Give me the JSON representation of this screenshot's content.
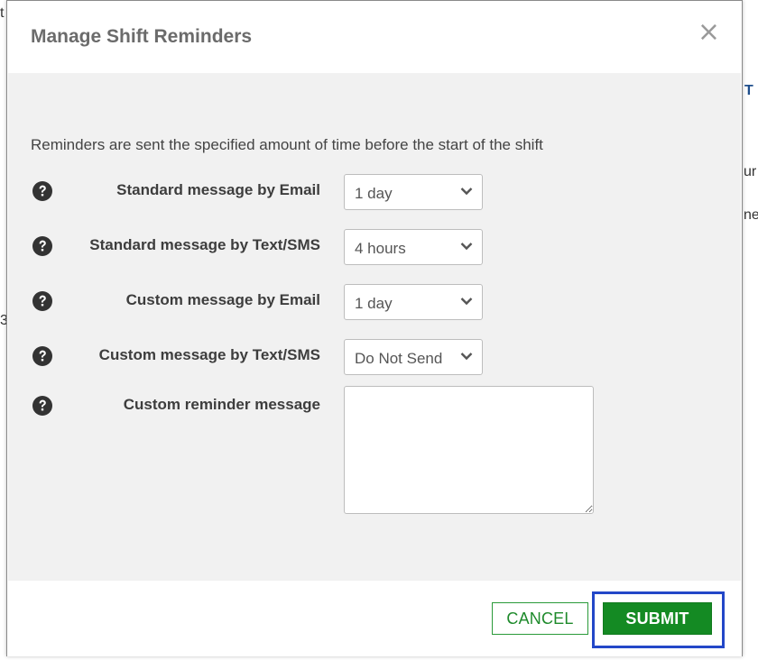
{
  "background": {
    "fragments": [
      "t",
      "T",
      "ur",
      "ne",
      "3"
    ]
  },
  "modal": {
    "title": "Manage Shift Reminders",
    "close_glyph": "×",
    "intro": "Reminders are sent the specified amount of time before the start of the shift",
    "rows": [
      {
        "label": "Standard message by Email",
        "value": "1 day"
      },
      {
        "label": "Standard message by Text/SMS",
        "value": "4 hours"
      },
      {
        "label": "Custom message by Email",
        "value": "1 day"
      },
      {
        "label": "Custom message by Text/SMS",
        "value": "Do Not Send"
      }
    ],
    "custom_reminder": {
      "label": "Custom reminder message",
      "value": ""
    },
    "footer": {
      "cancel_label": "CANCEL",
      "submit_label": "SUBMIT"
    }
  },
  "icons": {
    "help": "question-circle-icon",
    "dropdown": "chevron-down-icon",
    "close": "close-icon"
  },
  "colors": {
    "accent_green": "#148a23",
    "highlight_blue": "#2347c8",
    "body_gray": "#f1f1f1"
  }
}
